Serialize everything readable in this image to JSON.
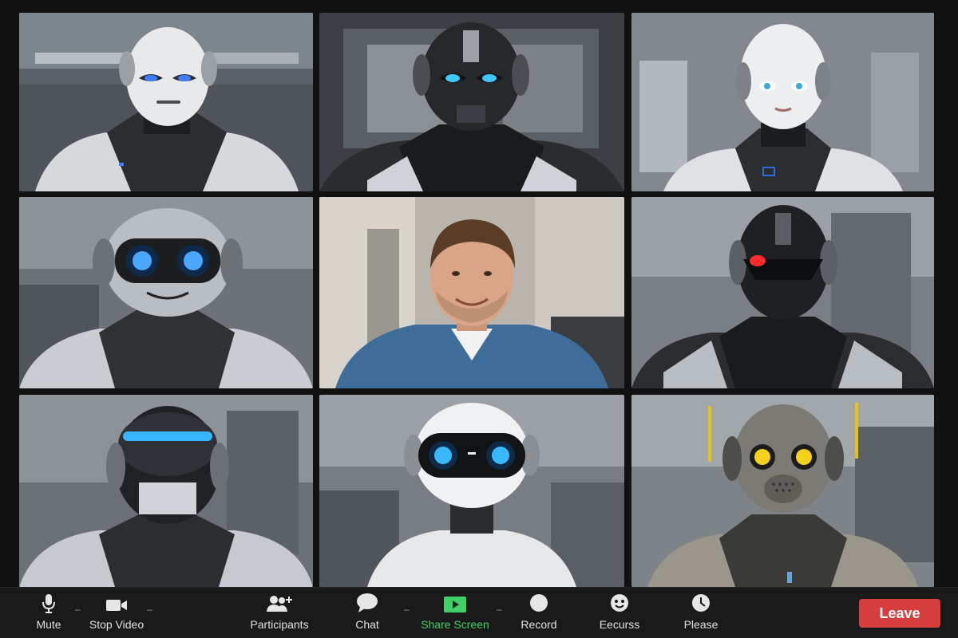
{
  "meeting": {
    "participants_tiles": [
      {
        "id": "robot-1",
        "kind": "robot",
        "style": "white",
        "eye_color": "#3f7cff"
      },
      {
        "id": "robot-2",
        "kind": "robot",
        "style": "black",
        "eye_color": "#3fc8ff"
      },
      {
        "id": "robot-3",
        "kind": "robot",
        "style": "android-face",
        "eye_color": "#3aa9d8"
      },
      {
        "id": "robot-4",
        "kind": "robot",
        "style": "round-goggles",
        "eye_color": "#4aa6ff"
      },
      {
        "id": "human-1",
        "kind": "human",
        "style": "smiling-man"
      },
      {
        "id": "robot-6",
        "kind": "robot",
        "style": "black-red-eye",
        "eye_color": "#ff2a2a"
      },
      {
        "id": "robot-7",
        "kind": "robot",
        "style": "visor",
        "eye_color": "#38b6ff"
      },
      {
        "id": "robot-8",
        "kind": "robot",
        "style": "cute-white",
        "eye_color": "#3ab8ff"
      },
      {
        "id": "robot-9",
        "kind": "robot",
        "style": "rusty-yellow-eye",
        "eye_color": "#f2d21b"
      }
    ]
  },
  "toolbar": {
    "mute": {
      "label": "Mute",
      "icon": "microphone-icon"
    },
    "stop_video": {
      "label": "Stop Video",
      "icon": "video-camera-icon"
    },
    "participants": {
      "label": "Participants",
      "icon": "participants-icon"
    },
    "chat": {
      "label": "Chat",
      "icon": "chat-bubble-icon"
    },
    "share_screen": {
      "label": "Share Screen",
      "icon": "share-screen-icon",
      "color": "#3fd06a"
    },
    "record": {
      "label": "Record",
      "icon": "record-icon"
    },
    "ecurss": {
      "label": "Eecurss",
      "icon": "reaction-icon"
    },
    "please": {
      "label": "Please",
      "icon": "clock-icon"
    },
    "leave": {
      "label": "Leave",
      "color": "#d63d3d"
    }
  }
}
